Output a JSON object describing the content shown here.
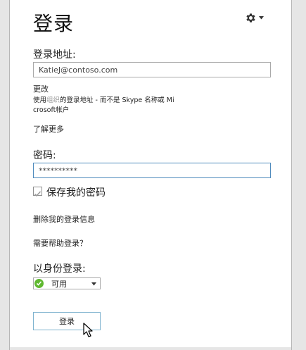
{
  "header": {
    "title": "登录",
    "settings_icon": "gear-icon"
  },
  "signin_address": {
    "label": "登录地址:",
    "value": "KatieJ@contoso.com",
    "change_link": "更改",
    "hint_prefix": "使用",
    "hint_emphasis": "组织",
    "hint_line1_rest": "的登录地址 - 而不是 Skype 名称或 Mi",
    "hint_line2": "crosoft帐户",
    "learn_more": "了解更多"
  },
  "password": {
    "label": "密码:",
    "value": "**********",
    "save_label": "保存我的密码",
    "save_checked": true
  },
  "links": {
    "delete_info": "删除我的登录信息",
    "need_help": "需要帮助登录？"
  },
  "status": {
    "label": "以身份登录:",
    "selected": "可用",
    "color": "#5fb830"
  },
  "signin_button": "登录",
  "colors": {
    "focus_border": "#4f8bbd",
    "button_border": "#7fb3cf",
    "frame": "#e6e6e6"
  }
}
